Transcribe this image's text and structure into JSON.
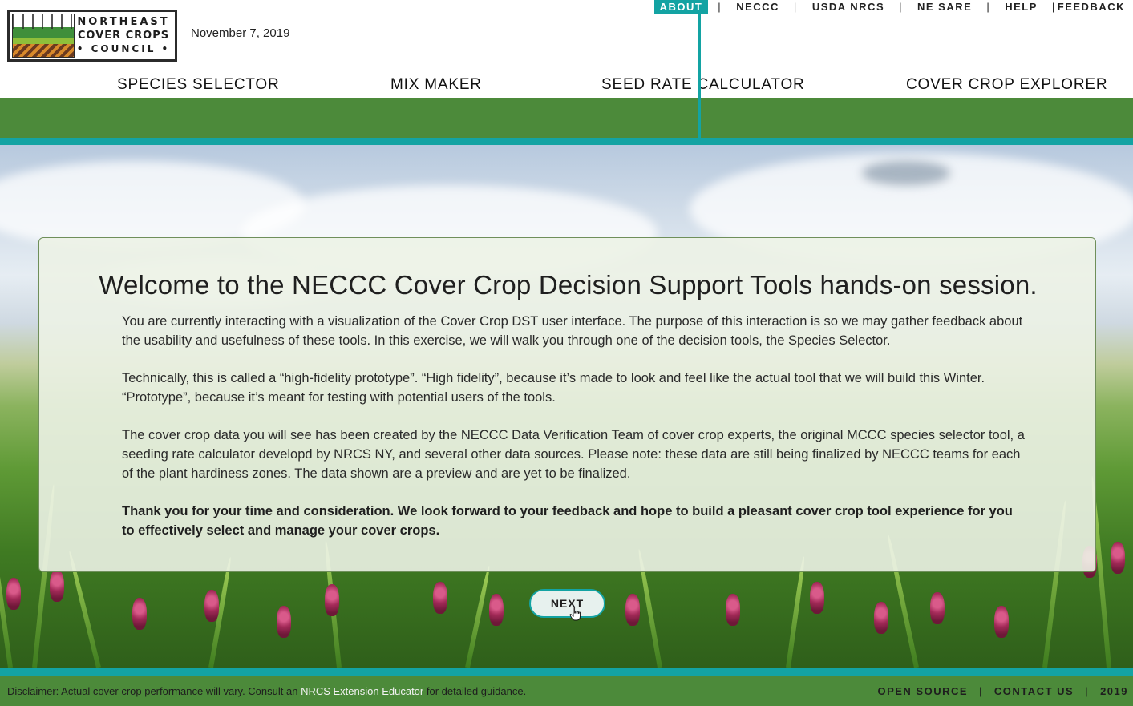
{
  "header": {
    "logo_lines": [
      "NORTHEAST",
      "COVER CROPS",
      "• COUNCIL •"
    ],
    "date": "November 7, 2019"
  },
  "topnav": {
    "items": [
      "ABOUT",
      "NECCC",
      "USDA NRCS",
      "NE SARE",
      "HELP",
      "FEEDBACK"
    ],
    "separator": "|",
    "active": "ABOUT"
  },
  "mainnav": {
    "items": [
      "SPECIES SELECTOR",
      "MIX MAKER",
      "SEED RATE CALCULATOR",
      "COVER CROP EXPLORER"
    ]
  },
  "welcome": {
    "title": "Welcome to the NECCC Cover Crop Decision Support Tools hands-on session.",
    "paragraphs": [
      "You are currently interacting with a visualization of the Cover Crop DST user interface. The purpose of this interaction is so we may gather feedback about the usability and usefulness of these tools. In this exercise, we will walk you through one of the decision tools, the Species Selector.",
      "Technically, this is called a “high-fidelity prototype”.  “High fidelity”, because it’s made to look and feel like the actual tool that we will build this Winter. “Prototype”, because it’s meant for testing with potential users of the tools.",
      "The cover crop data you will see has been created by the NECCC Data Verification Team of cover crop experts, the original MCCC species selector tool, a seeding rate calculator developd by NRCS NY, and several other data sources. Please note: these data are still being finalized by NECCC teams for each of the plant hardiness zones. The data shown are a preview and are yet to be finalized."
    ],
    "closing": "Thank you for your time and consideration. We look forward to your feedback and hope to build a pleasant cover crop tool experience for you to effectively select and manage your cover crops.",
    "next_label": "NEXT"
  },
  "footer": {
    "disclaimer_prefix": "Disclaimer: Actual cover crop performance will vary. Consult an ",
    "disclaimer_link": "NRCS Extension Educator",
    "disclaimer_suffix": " for detailed guidance.",
    "links": [
      "OPEN SOURCE",
      "CONTACT US",
      "2019"
    ],
    "separator": "|"
  },
  "colors": {
    "teal": "#13a3a3",
    "green": "#4c8a3a"
  }
}
